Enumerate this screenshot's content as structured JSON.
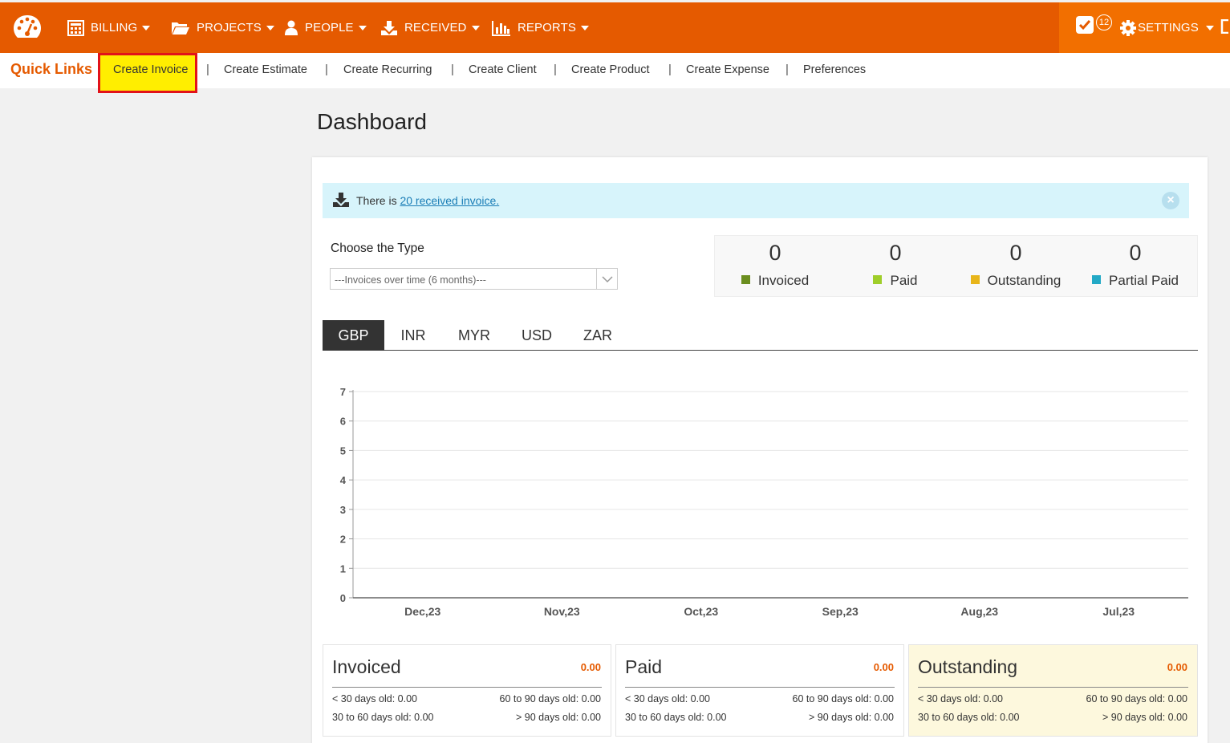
{
  "nav": {
    "items": [
      {
        "label": "BILLING",
        "icon": "calculator-icon"
      },
      {
        "label": "PROJECTS",
        "icon": "folder-icon"
      },
      {
        "label": "PEOPLE",
        "icon": "user-icon"
      },
      {
        "label": "RECEIVED",
        "icon": "download-icon"
      },
      {
        "label": "REPORTS",
        "icon": "bar-chart-icon"
      }
    ],
    "notification_count": "12",
    "settings_label": "SETTINGS"
  },
  "quick_links": {
    "title": "Quick Links",
    "items": [
      "Create Invoice",
      "Create Estimate",
      "Create Recurring",
      "Create Client",
      "Create Product",
      "Create Expense",
      "Preferences"
    ]
  },
  "page": {
    "title": "Dashboard"
  },
  "alert": {
    "prefix": "There is",
    "link": "20 received invoice."
  },
  "filter": {
    "label": "Choose the Type",
    "selected": "---Invoices over time (6 months)---"
  },
  "stats": [
    {
      "value": "0",
      "label": "Invoiced",
      "color": "#6b8e1f"
    },
    {
      "value": "0",
      "label": "Paid",
      "color": "#9fce2a"
    },
    {
      "value": "0",
      "label": "Outstanding",
      "color": "#e8b51a"
    },
    {
      "value": "0",
      "label": "Partial Paid",
      "color": "#23a9c6"
    }
  ],
  "currency_tabs": [
    "GBP",
    "INR",
    "MYR",
    "USD",
    "ZAR"
  ],
  "active_tab": "GBP",
  "chart_data": {
    "type": "line",
    "categories": [
      "Dec,23",
      "Nov,23",
      "Oct,23",
      "Sep,23",
      "Aug,23",
      "Jul,23"
    ],
    "series": [],
    "ylim": [
      0,
      7
    ],
    "yticks": [
      "0",
      "1",
      "2",
      "3",
      "4",
      "5",
      "6",
      "7"
    ],
    "grid": true
  },
  "summaries": [
    {
      "title": "Invoiced",
      "amount": "0.00",
      "lt30": "< 30 days old: 0.00",
      "d30_60": "30 to 60 days old: 0.00",
      "d60_90": "60 to 90 days old: 0.00",
      "gt90": "> 90 days old: 0.00"
    },
    {
      "title": "Paid",
      "amount": "0.00",
      "lt30": "< 30 days old: 0.00",
      "d30_60": "30 to 60 days old: 0.00",
      "d60_90": "60 to 90 days old: 0.00",
      "gt90": "> 90 days old: 0.00"
    },
    {
      "title": "Outstanding",
      "amount": "0.00",
      "lt30": "< 30 days old: 0.00",
      "d30_60": "30 to 60 days old: 0.00",
      "d60_90": "60 to 90 days old: 0.00",
      "gt90": "> 90 days old: 0.00"
    }
  ]
}
